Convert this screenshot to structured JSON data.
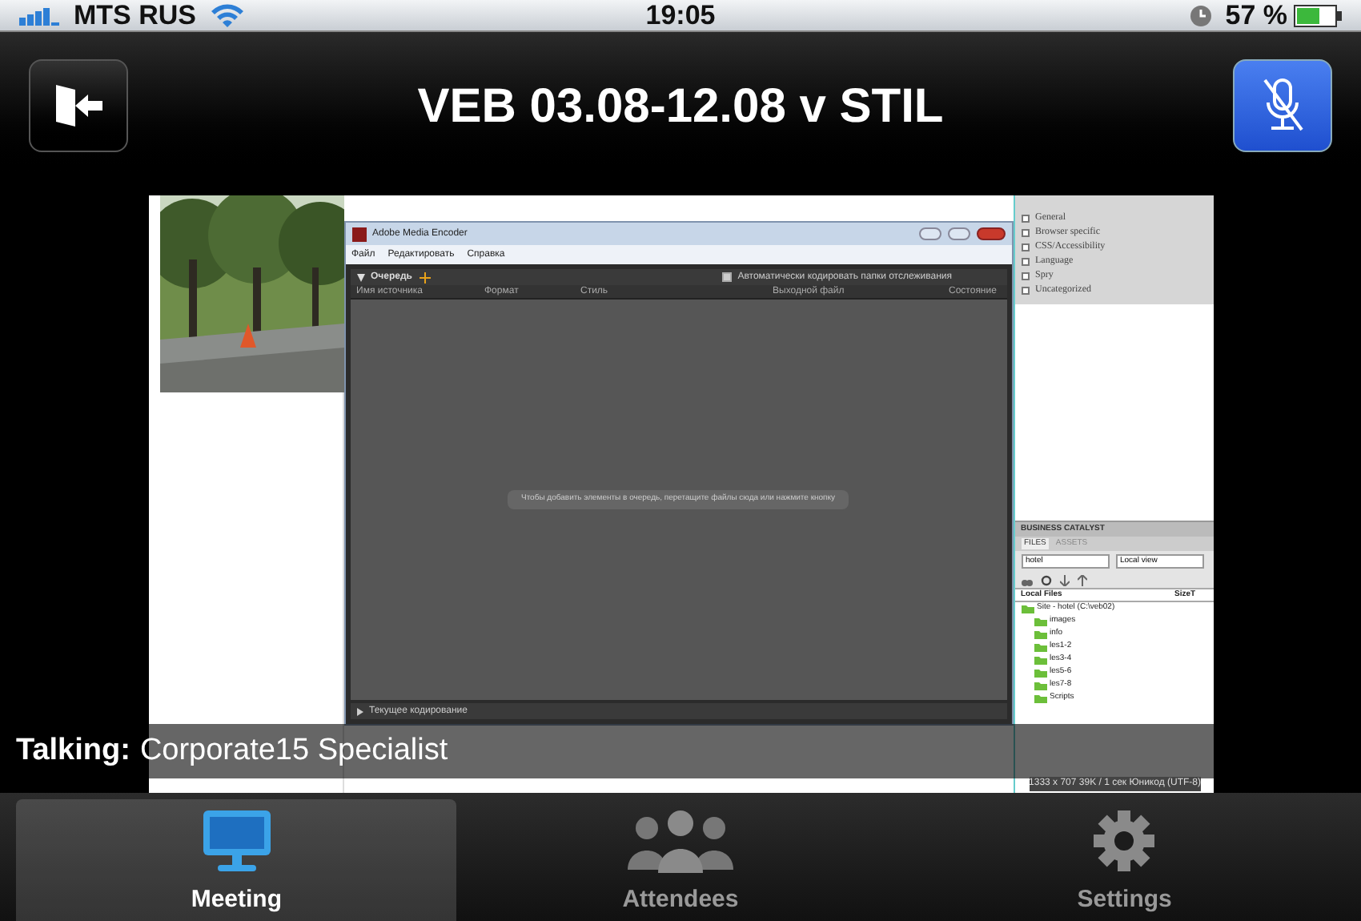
{
  "status_bar": {
    "carrier": "MTS RUS",
    "time": "19:05",
    "battery": "57 %"
  },
  "nav_bar": {
    "title": "VEB 03.08-12.08 v STIL",
    "mic_muted": true
  },
  "shared_screen": {
    "photo": {
      "kind": "picture"
    },
    "encoder": {
      "title": "Adobe Media Encoder",
      "menu": [
        "Файл",
        "Редактировать",
        "Справка"
      ],
      "queue_label": "Очередь",
      "auto_encode": {
        "label": "Автоматически кодировать папки отслеживания",
        "checked": true
      },
      "columns": [
        "Имя источника",
        "Формат",
        "Стиль",
        "Выходной файл",
        "Состояние"
      ],
      "hint": "Чтобы добавить элементы в очередь, перетащите файлы сюда или нажмите кнопку",
      "sections": [
        "Текущее кодирование"
      ]
    },
    "properties": [
      "General",
      "Browser specific",
      "CSS/Accessibility",
      "Language",
      "Spry",
      "Uncategorized"
    ],
    "files_panel": {
      "header": "BUSINESS CATALYST",
      "tabs": [
        {
          "label": "FILES",
          "selected": true
        },
        {
          "label": "ASSETS",
          "selected": false
        }
      ],
      "site": "hotel",
      "view": "Local view",
      "columns": [
        "Local Files",
        "Size",
        "T"
      ],
      "root": "Site - hotel (C:\\veb02)",
      "folders": [
        "images",
        "info",
        "les1-2",
        "les3-4",
        "les5-6",
        "les7-8",
        "Scripts"
      ]
    },
    "status_text": "1333 x 707  39K / 1 сек  Юникод (UTF-8)"
  },
  "talking": {
    "label": "Talking:",
    "name": "Corporate15 Specialist"
  },
  "tab_bar": [
    {
      "label": "Meeting",
      "selected": true,
      "kind": "monitor"
    },
    {
      "label": "Attendees",
      "selected": false,
      "kind": "people"
    },
    {
      "label": "Settings",
      "selected": false,
      "kind": "gear"
    }
  ]
}
